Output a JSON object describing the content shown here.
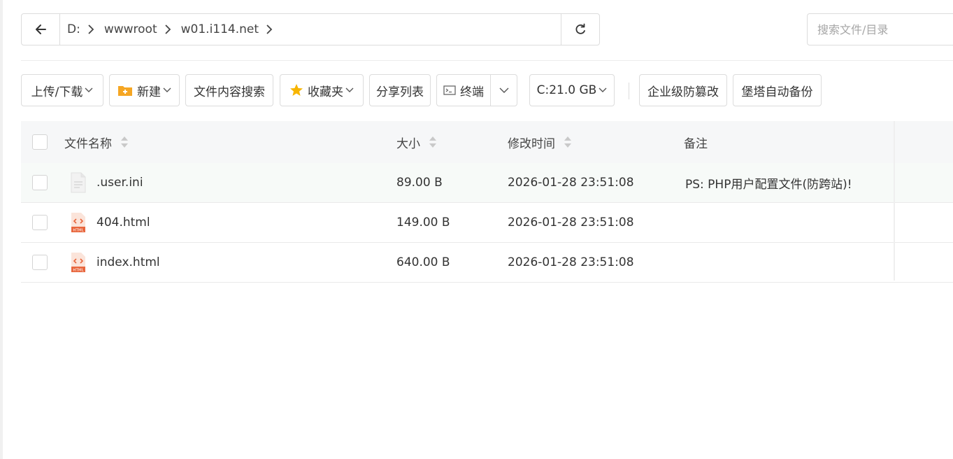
{
  "breadcrumb": {
    "items": [
      "D:",
      "wwwroot",
      "w01.i114.net"
    ]
  },
  "search": {
    "placeholder": "搜索文件/目录"
  },
  "toolbar": {
    "upload_download": "上传/下载",
    "new": "新建",
    "content_search": "文件内容搜索",
    "favorites": "收藏夹",
    "share_list": "分享列表",
    "terminal": "终端",
    "disk": "C:21.0 GB",
    "tamper_protect": "企业级防篡改",
    "auto_backup": "堡塔自动备份"
  },
  "table": {
    "headers": {
      "name": "文件名称",
      "size": "大小",
      "mtime": "修改时间",
      "note": "备注"
    },
    "rows": [
      {
        "name": ".user.ini",
        "size": "89.00 B",
        "mtime": "2026-01-28 23:51:08",
        "note": "PS: PHP用户配置文件(防跨站)!",
        "icon": "ini-file-icon"
      },
      {
        "name": "404.html",
        "size": "149.00 B",
        "mtime": "2026-01-28 23:51:08",
        "note": "",
        "icon": "html-file-icon"
      },
      {
        "name": "index.html",
        "size": "640.00 B",
        "mtime": "2026-01-28 23:51:08",
        "note": "",
        "icon": "html-file-icon"
      }
    ]
  },
  "colors": {
    "accent_folder": "#f5a623",
    "star": "#f7b500",
    "html_icon": "#e8663d"
  }
}
